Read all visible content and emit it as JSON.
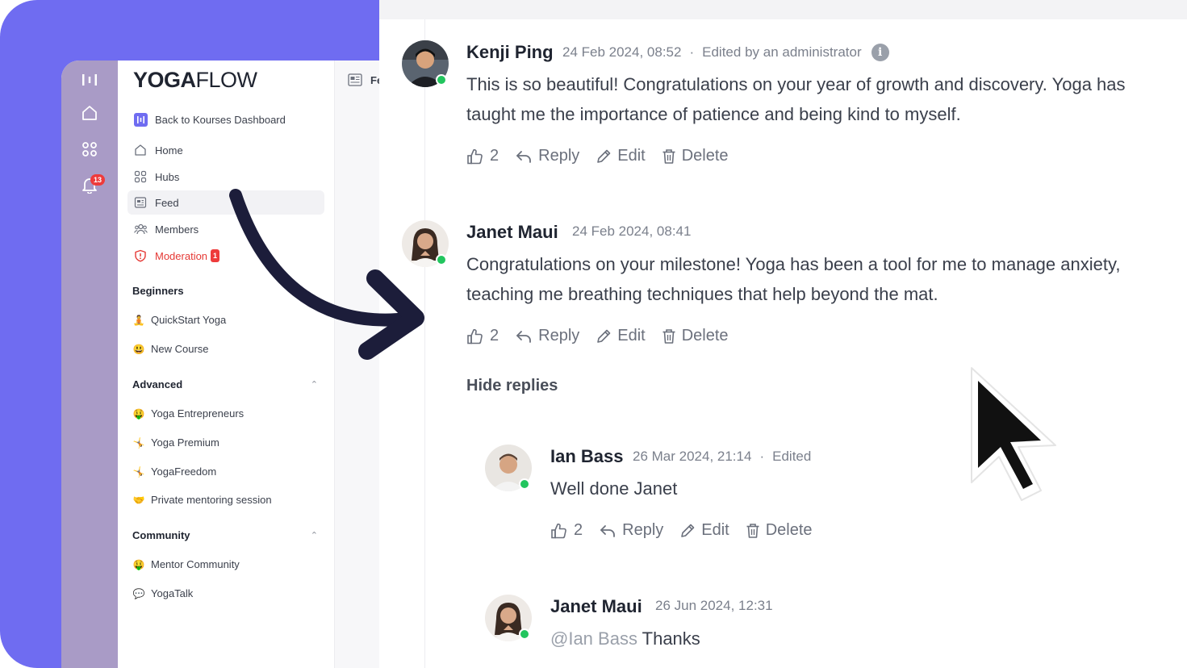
{
  "sidebar": {
    "logo_bold": "YOGA",
    "logo_light": "FLOW",
    "back_label": "Back to Kourses Dashboard",
    "nav": [
      {
        "label": "Home",
        "icon": "home-icon"
      },
      {
        "label": "Hubs",
        "icon": "hubs-icon"
      },
      {
        "label": "Feed",
        "icon": "feed-icon"
      },
      {
        "label": "Members",
        "icon": "members-icon"
      },
      {
        "label": "Moderation",
        "icon": "shield-icon",
        "badge": "1"
      }
    ],
    "sections": [
      {
        "title": "Beginners",
        "items": [
          {
            "emoji": "🧘",
            "label": "QuickStart Yoga"
          },
          {
            "emoji": "😃",
            "label": "New Course"
          }
        ]
      },
      {
        "title": "Advanced",
        "chevron": "⌃",
        "items": [
          {
            "emoji": "🤑",
            "label": "Yoga Entrepreneurs"
          },
          {
            "emoji": "🤸",
            "label": "Yoga Premium"
          },
          {
            "emoji": "🤸",
            "label": "YogaFreedom"
          },
          {
            "emoji": "🤝",
            "label": "Private mentoring session"
          }
        ]
      },
      {
        "title": "Community",
        "chevron": "⌃",
        "items": [
          {
            "emoji": "🤑",
            "label": "Mentor Community"
          },
          {
            "emoji": "💬",
            "label": "YogaTalk"
          }
        ]
      }
    ]
  },
  "rail": {
    "notification_count": "13"
  },
  "midcol": {
    "header": "Fe"
  },
  "comments": [
    {
      "name": "Kenji Ping",
      "date": "24 Feb 2024, 08:52",
      "dot": "·",
      "edited": "Edited by an administrator",
      "info": "i",
      "text_line1": "This is so beautiful! Congratulations on your year of growth and discovery. Yoga has",
      "text_line2": "taught me the importance of patience and being kind to myself.",
      "likes": "2"
    },
    {
      "name": "Janet Maui",
      "date": "24 Feb 2024, 08:41",
      "text_line1": "Congratulations on your milestone! Yoga has been a tool for me to manage anxiety,",
      "text_line2": "teaching me breathing techniques that help beyond the mat.",
      "likes": "2"
    }
  ],
  "replies": [
    {
      "name": "Ian Bass",
      "date": "26 Mar 2024, 21:14",
      "dot": "·",
      "edited": "Edited",
      "text": "Well done Janet",
      "likes": "2"
    },
    {
      "name": "Janet Maui",
      "date": "26 Jun 2024, 12:31",
      "mention": "@Ian Bass",
      "text": " Thanks"
    }
  ],
  "actions": {
    "reply": "Reply",
    "edit": "Edit",
    "delete": "Delete"
  },
  "hide_replies": "Hide replies",
  "colors": {
    "accent_purple": "#6f6cf1",
    "rail": "#a99bc6",
    "online": "#22c55e",
    "danger": "#e53935"
  }
}
